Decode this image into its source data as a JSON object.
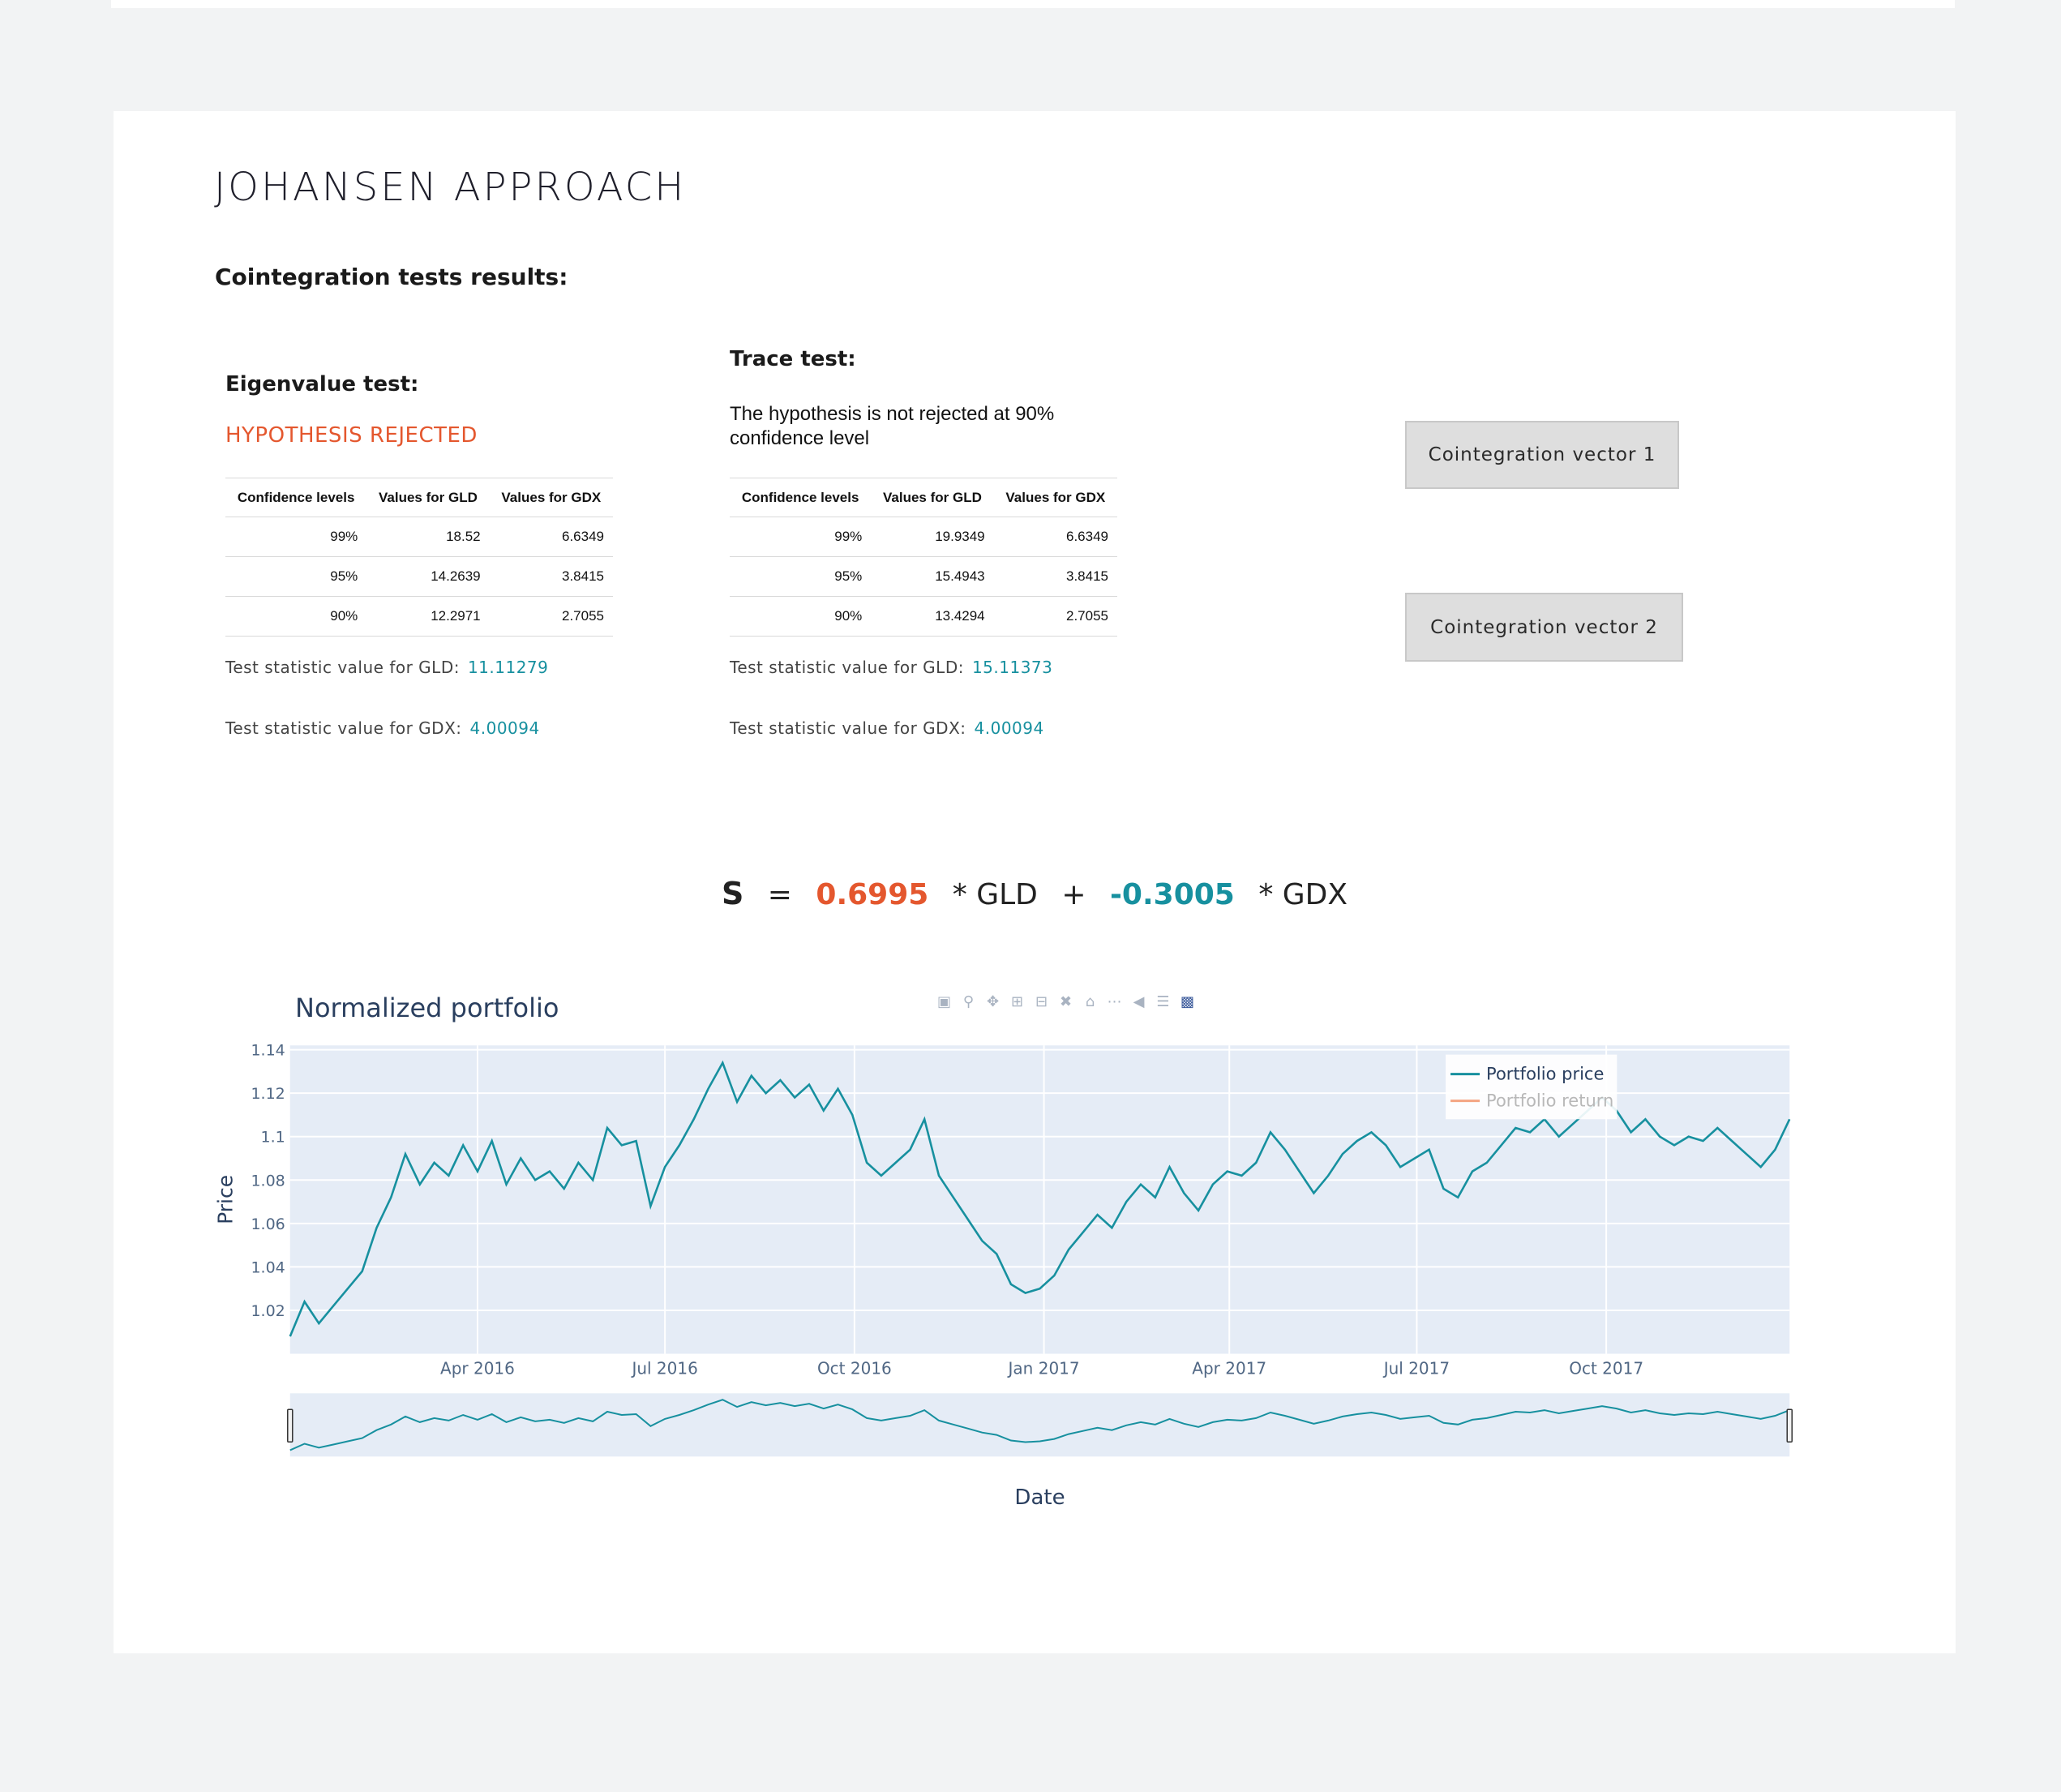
{
  "page": {
    "title": "JOHANSEN APPROACH",
    "section_title": "Cointegration tests results:"
  },
  "eigen": {
    "title": "Eigenvalue test:",
    "status": "HYPOTHESIS REJECTED",
    "headers": [
      "Confidence levels",
      "Values for GLD",
      "Values for GDX"
    ],
    "rows": [
      [
        "99%",
        "18.52",
        "6.6349"
      ],
      [
        "95%",
        "14.2639",
        "3.8415"
      ],
      [
        "90%",
        "12.2971",
        "2.7055"
      ]
    ],
    "stat_gld_label": "Test statistic value for GLD:",
    "stat_gld_value": "11.11279",
    "stat_gdx_label": "Test statistic value for GDX:",
    "stat_gdx_value": "4.00094"
  },
  "trace": {
    "title": "Trace test:",
    "status": "The hypothesis is not rejected at 90% confidence level",
    "headers": [
      "Confidence levels",
      "Values for GLD",
      "Values for GDX"
    ],
    "rows": [
      [
        "99%",
        "19.9349",
        "6.6349"
      ],
      [
        "95%",
        "15.4943",
        "3.8415"
      ],
      [
        "90%",
        "13.4294",
        "2.7055"
      ]
    ],
    "stat_gld_label": "Test statistic value for GLD:",
    "stat_gld_value": "15.11373",
    "stat_gdx_label": "Test statistic value for GDX:",
    "stat_gdx_value": "4.00094"
  },
  "buttons": {
    "vector1": "Cointegration vector 1",
    "vector2": "Cointegration vector 2"
  },
  "equation": {
    "lhs": "S",
    "eq": "=",
    "coef1": "0.6995",
    "term1": "* GLD",
    "plus": "+",
    "coef2": "-0.3005",
    "term2": "* GDX"
  },
  "modebar_icons": [
    "camera-icon",
    "zoom-icon",
    "pan-icon",
    "zoom-in-icon",
    "zoom-out-icon",
    "autoscale-icon",
    "reset-axes-icon",
    "spike-lines-icon",
    "hover-closest-icon",
    "hover-compare-icon",
    "plotly-logo-icon"
  ],
  "colors": {
    "accent_orange": "#e4572e",
    "accent_teal": "#17909f",
    "plot_bg": "#e5ecf6",
    "line": "#17909f",
    "return_line": "#f4a582"
  },
  "chart_data": {
    "type": "line",
    "title": "Normalized portfolio",
    "xlabel": "Date",
    "ylabel": "Price",
    "x_ticks": [
      "Apr 2016",
      "Jul 2016",
      "Oct 2016",
      "Jan 2017",
      "Apr 2017",
      "Jul 2017",
      "Oct 2017"
    ],
    "y_ticks": [
      "1.02",
      "1.04",
      "1.06",
      "1.08",
      "1.1",
      "1.12",
      "1.14"
    ],
    "xlim": [
      "2016-01-01",
      "2017-12-29"
    ],
    "ylim": [
      1.0,
      1.142
    ],
    "legend": "top-right",
    "grid": true,
    "rangeslider": true,
    "series": [
      {
        "name": "Portfolio price",
        "x": [
          "2016-01-01",
          "2016-01-08",
          "2016-01-15",
          "2016-01-22",
          "2016-01-29",
          "2016-02-05",
          "2016-02-12",
          "2016-02-19",
          "2016-02-26",
          "2016-03-04",
          "2016-03-11",
          "2016-03-18",
          "2016-03-25",
          "2016-04-01",
          "2016-04-08",
          "2016-04-15",
          "2016-04-22",
          "2016-04-29",
          "2016-05-06",
          "2016-05-13",
          "2016-05-20",
          "2016-05-27",
          "2016-06-03",
          "2016-06-10",
          "2016-06-17",
          "2016-06-24",
          "2016-07-01",
          "2016-07-08",
          "2016-07-15",
          "2016-07-22",
          "2016-07-29",
          "2016-08-05",
          "2016-08-12",
          "2016-08-19",
          "2016-08-26",
          "2016-09-02",
          "2016-09-09",
          "2016-09-16",
          "2016-09-23",
          "2016-09-30",
          "2016-10-07",
          "2016-10-14",
          "2016-10-21",
          "2016-10-28",
          "2016-11-04",
          "2016-11-11",
          "2016-11-18",
          "2016-11-25",
          "2016-12-02",
          "2016-12-09",
          "2016-12-16",
          "2016-12-23",
          "2016-12-30",
          "2017-01-06",
          "2017-01-13",
          "2017-01-20",
          "2017-01-27",
          "2017-02-03",
          "2017-02-10",
          "2017-02-17",
          "2017-02-24",
          "2017-03-03",
          "2017-03-10",
          "2017-03-17",
          "2017-03-24",
          "2017-03-31",
          "2017-04-07",
          "2017-04-14",
          "2017-04-21",
          "2017-04-28",
          "2017-05-05",
          "2017-05-12",
          "2017-05-19",
          "2017-05-26",
          "2017-06-02",
          "2017-06-09",
          "2017-06-16",
          "2017-06-23",
          "2017-06-30",
          "2017-07-07",
          "2017-07-14",
          "2017-07-21",
          "2017-07-28",
          "2017-08-04",
          "2017-08-11",
          "2017-08-18",
          "2017-08-25",
          "2017-09-01",
          "2017-09-08",
          "2017-09-15",
          "2017-09-22",
          "2017-09-29",
          "2017-10-06",
          "2017-10-13",
          "2017-10-20",
          "2017-10-27",
          "2017-11-03",
          "2017-11-10",
          "2017-11-17",
          "2017-11-24",
          "2017-12-01",
          "2017-12-08",
          "2017-12-15",
          "2017-12-22",
          "2017-12-29"
        ],
        "values": [
          1.008,
          1.024,
          1.014,
          1.022,
          1.03,
          1.038,
          1.058,
          1.072,
          1.092,
          1.078,
          1.088,
          1.082,
          1.096,
          1.084,
          1.098,
          1.078,
          1.09,
          1.08,
          1.084,
          1.076,
          1.088,
          1.08,
          1.104,
          1.096,
          1.098,
          1.068,
          1.086,
          1.096,
          1.108,
          1.122,
          1.134,
          1.116,
          1.128,
          1.12,
          1.126,
          1.118,
          1.124,
          1.112,
          1.122,
          1.11,
          1.088,
          1.082,
          1.088,
          1.094,
          1.108,
          1.082,
          1.072,
          1.062,
          1.052,
          1.046,
          1.032,
          1.028,
          1.03,
          1.036,
          1.048,
          1.056,
          1.064,
          1.058,
          1.07,
          1.078,
          1.072,
          1.086,
          1.074,
          1.066,
          1.078,
          1.084,
          1.082,
          1.088,
          1.102,
          1.094,
          1.084,
          1.074,
          1.082,
          1.092,
          1.098,
          1.102,
          1.096,
          1.086,
          1.09,
          1.094,
          1.076,
          1.072,
          1.084,
          1.088,
          1.096,
          1.104,
          1.102,
          1.108,
          1.1,
          1.106,
          1.112,
          1.118,
          1.112,
          1.102,
          1.108,
          1.1,
          1.096,
          1.1,
          1.098,
          1.104,
          1.098,
          1.092,
          1.086,
          1.094,
          1.108
        ]
      },
      {
        "name": "Portfolio return",
        "values": []
      }
    ]
  }
}
